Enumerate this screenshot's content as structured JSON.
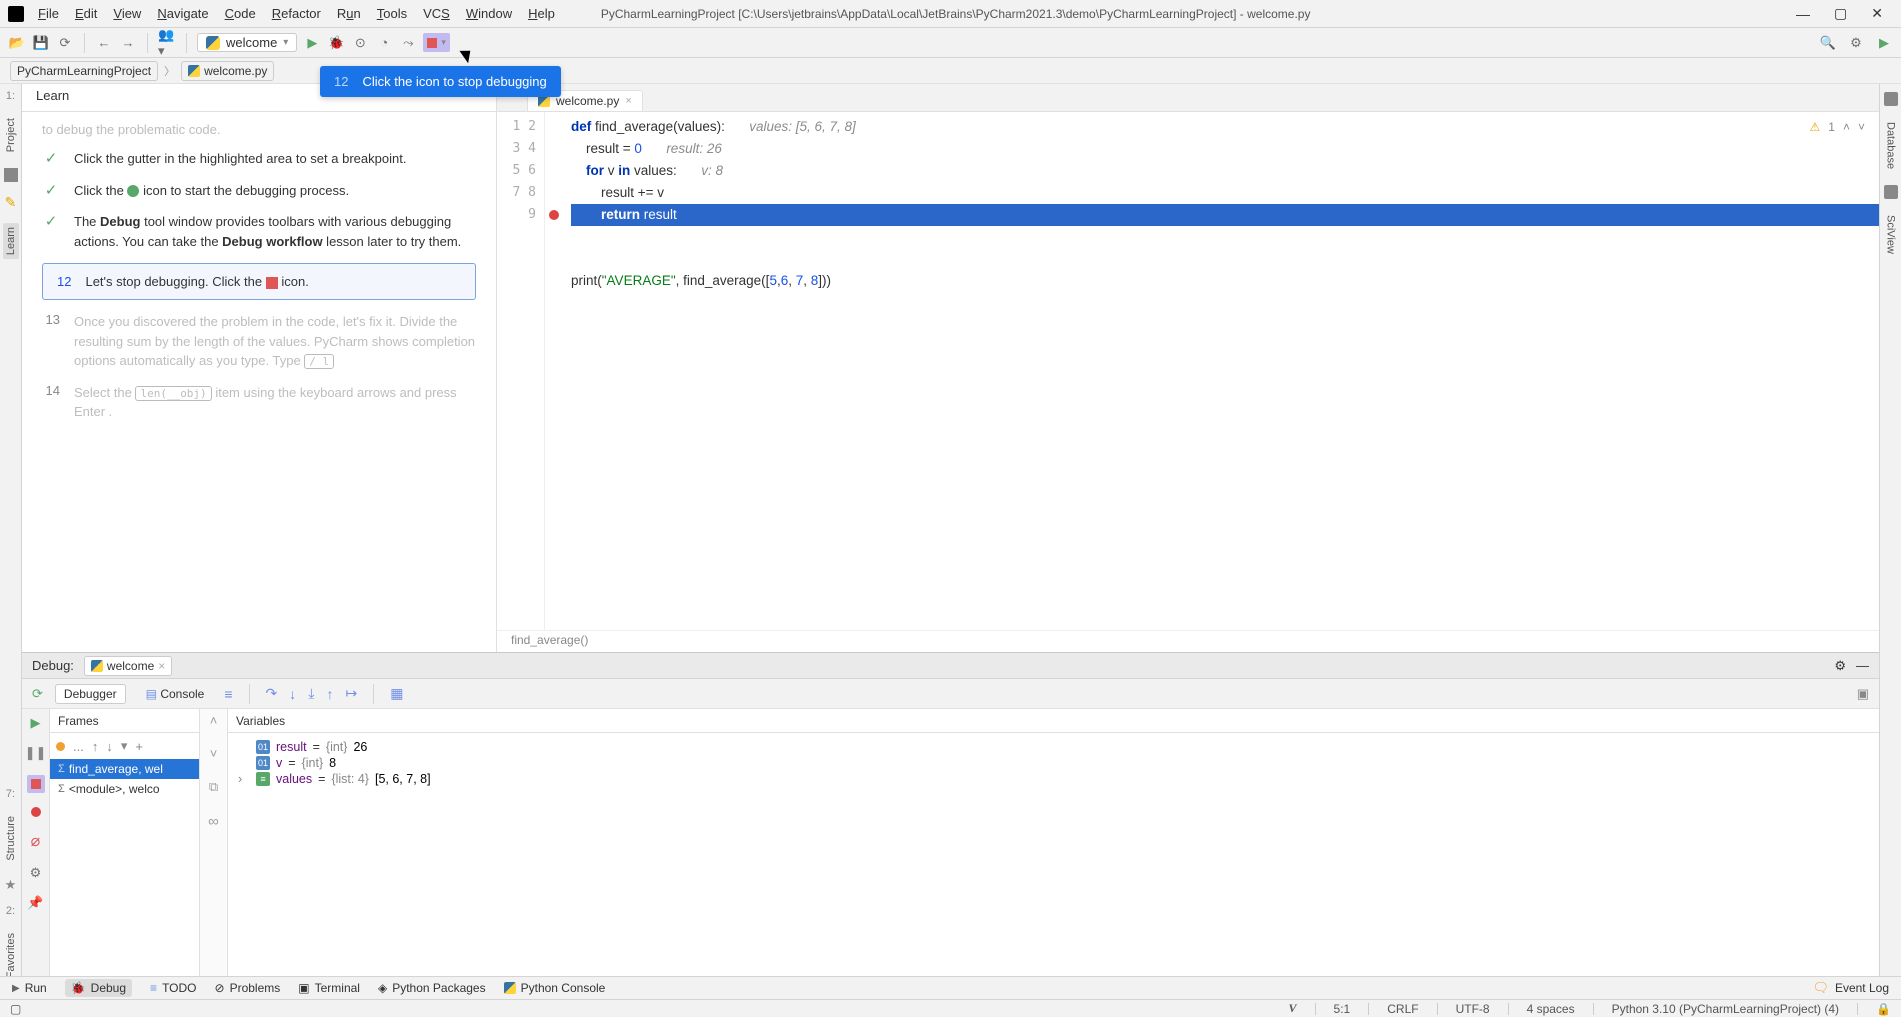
{
  "menus": [
    "File",
    "Edit",
    "View",
    "Navigate",
    "Code",
    "Refactor",
    "Run",
    "Tools",
    "VCS",
    "Window",
    "Help"
  ],
  "title_path": "PyCharmLearningProject [C:\\Users\\jetbrains\\AppData\\Local\\JetBrains\\PyCharm2021.3\\demo\\PyCharmLearningProject] - welcome.py",
  "run_config": "welcome",
  "breadcrumb": {
    "project": "PyCharmLearningProject",
    "file": "welcome.py"
  },
  "callout": {
    "num": "12",
    "text": "Click the icon to stop debugging"
  },
  "learn": {
    "tab": "Learn",
    "trunc": "to debug the problematic code.",
    "step_breakpoint": "Click the gutter in the highlighted area to set a breakpoint.",
    "step_startdbg_pre": "Click the ",
    "step_startdbg_post": " icon to start the debugging process.",
    "step_debugwin": "The Debug tool window provides toolbars with various debugging actions. You can take the Debug workflow lesson later to try them.",
    "bold_debug": "Debug",
    "bold_workflow": "Debug workflow",
    "active_num": "12",
    "active_pre": "Let's stop debugging. Click the ",
    "active_post": " icon.",
    "step13_num": "13",
    "step13": "Once you discovered the problem in the code, let's fix it. Divide the resulting sum by the length of the values. PyCharm shows completion options automatically as you type. Type",
    "step13_kbd": " / l",
    "step14_num": "14",
    "step14_pre": "Select the",
    "step14_kbd": "len(__obj)",
    "step14_post": "item using the keyboard arrows and press Enter .",
    "left_labels": {
      "project": "Project",
      "learn": "Learn",
      "structure": "Structure",
      "favorites": "Favorites"
    },
    "right_labels": {
      "database": "Database",
      "sciview": "SciView"
    }
  },
  "editor": {
    "tab": "welcome.py",
    "warn_count": "1",
    "lines": [
      "1",
      "2",
      "3",
      "4",
      "5",
      "6",
      "7",
      "8",
      "9"
    ],
    "code": {
      "l1_def": "def ",
      "l1_fn": "find_average",
      "l1_rest": "(values):",
      "l1_hint": "values: [5, 6, 7, 8]",
      "l2_pre": "    result = ",
      "l2_num": "0",
      "l2_hint": "result: 26",
      "l3_for": "    for ",
      "l3_v": "v ",
      "l3_in": "in ",
      "l3_vals": "values:",
      "l3_hint": "v: 8",
      "l4": "        result += v",
      "l5_ret": "        return ",
      "l5_res": "result",
      "l8_print": "print(",
      "l8_str": "\"AVERAGE\"",
      "l8_mid": ", find_average([",
      "l8_n1": "5",
      "l8_c": ",",
      "l8_n2": "6",
      "l8_c2": ", ",
      "l8_n3": "7",
      "l8_c3": ", ",
      "l8_n4": "8",
      "l8_end": "]))"
    },
    "crumb": "find_average()"
  },
  "debugwin": {
    "title": "Debug:",
    "tab": "welcome",
    "sub_debugger": "Debugger",
    "sub_console": "Console",
    "frames_title": "Frames",
    "vars_title": "Variables",
    "frames": [
      {
        "label": "find_average, wel",
        "sel": true
      },
      {
        "label": "<module>, welco",
        "sel": false
      }
    ],
    "vars": [
      {
        "kind": "01",
        "name": "result",
        "eq": " = ",
        "type": "{int} ",
        "val": "26"
      },
      {
        "kind": "01",
        "name": "v",
        "eq": " = ",
        "type": "{int} ",
        "val": "8"
      },
      {
        "kind": "list",
        "chev": true,
        "name": "values",
        "eq": " = ",
        "type": "{list: 4} ",
        "val": "[5, 6, 7, 8]"
      }
    ]
  },
  "bottom": {
    "run": "Run",
    "debug": "Debug",
    "todo": "TODO",
    "problems": "Problems",
    "terminal": "Terminal",
    "pypkg": "Python Packages",
    "pycon": "Python Console",
    "eventlog": "Event Log"
  },
  "status": {
    "pos": "5:1",
    "sep": "CRLF",
    "enc": "UTF-8",
    "indent": "4 spaces",
    "interp": "Python 3.10 (PyCharmLearningProject) (4)"
  }
}
